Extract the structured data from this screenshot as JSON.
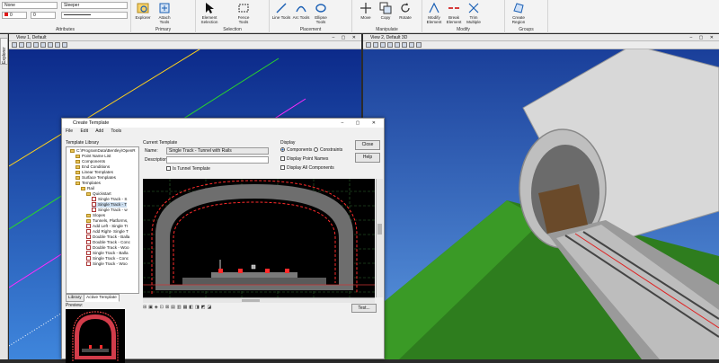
{
  "ribbon": {
    "attributes": {
      "level": "None",
      "style": "Sleeper",
      "color": "0",
      "weight": "0",
      "label": "Attributes"
    },
    "primary": {
      "label": "Primary",
      "explorer": "Explorer",
      "attach_tools": "Attach Tools"
    },
    "selection": {
      "label": "Selection",
      "element_selection": "Element Selection",
      "fence_tools": "Fence Tools"
    },
    "placement": {
      "label": "Placement",
      "line_tools": "Line Tools",
      "arc_tools": "Arc Tools",
      "ellipse_tools": "Ellipse Tools"
    },
    "manipulate": {
      "label": "Manipulate",
      "move": "Move",
      "copy": "Copy",
      "rotate": "Rotate"
    },
    "modify": {
      "label": "Modify",
      "modify_element": "Modify Element",
      "break_element": "Break Element",
      "trim_multiple": "Trim Multiple"
    },
    "groups": {
      "label": "Groups",
      "create_region": "Create Region"
    }
  },
  "views": {
    "view1_title": "View 1, Default",
    "view2_title": "View 2, Default 3D",
    "side_tab": "Explorer"
  },
  "dialog": {
    "title": "Create Template",
    "menu": [
      "File",
      "Edit",
      "Add",
      "Tools"
    ],
    "library_label": "Template Library",
    "current_template_label": "Current Template",
    "name_label": "Name:",
    "name_value": "Single Track - Tunnel with Rails",
    "description_label": "Description:",
    "description_value": "",
    "is_tunnel": "Is Tunnel Template",
    "display_label": "Display",
    "components": "Components",
    "constraints": "Constraints",
    "display_point_names": "Display Point Names",
    "display_all_components": "Display All Components",
    "close": "Close",
    "help": "Help",
    "test": "Test...",
    "preview_label": "Preview:",
    "tab_library": "Library",
    "tab_active": "Active Template",
    "tree": [
      "C:\\ProgramData\\Bentley\\OpenR",
      "Point Name List",
      "Components",
      "End Conditions",
      "Linear Templates",
      "Surface Templates",
      "Templates",
      "Rail",
      "Quickstart",
      "Single Track - S",
      "Single Track - T",
      "Single Track - w",
      "Slopes",
      "Tunnels, Platforms,",
      "Add Left - Single Tr",
      "Add Right- Single T",
      "Double Track - Balla",
      "Double Track - Conc",
      "Double Track - Woo",
      "Single Track - Balla",
      "Single Track - Conc",
      "Single Track - Woo"
    ],
    "scale_ticks": [
      "9",
      "8",
      "7",
      "6",
      "5",
      "4",
      "3",
      "2",
      "1",
      "0"
    ]
  },
  "colors": {
    "accent": "#1a5fb4",
    "grid": "#2f6b2f",
    "dash_red": "#ff2b2b"
  }
}
